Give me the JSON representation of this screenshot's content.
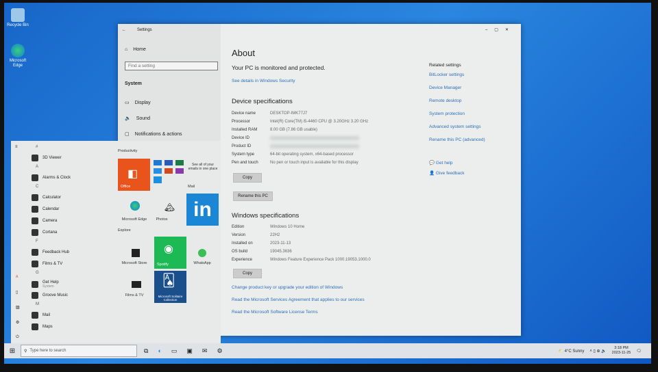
{
  "desktop": {
    "icons": [
      {
        "label": "Recycle Bin",
        "icon": "recycle-bin-icon"
      },
      {
        "label": "Microsoft Edge",
        "icon": "edge-icon"
      }
    ]
  },
  "settings": {
    "title": "Settings",
    "sidebar": {
      "home": "Home",
      "search_placeholder": "Find a setting",
      "section": "System",
      "items": [
        "Display",
        "Sound",
        "Notifications & actions"
      ]
    },
    "page_title": "About",
    "protected": "Your PC is monitored and protected.",
    "security_link": "See details in Windows Security",
    "device_specs": {
      "heading": "Device specifications",
      "rows": [
        {
          "k": "Device name",
          "v": "DESKTOP-IMK77J7"
        },
        {
          "k": "Processor",
          "v": "Intel(R) Core(TM) i5-4460  CPU @ 3.20GHz   3.20 GHz"
        },
        {
          "k": "Installed RAM",
          "v": "8.00 GB (7.86 GB usable)"
        },
        {
          "k": "Device ID",
          "v": ""
        },
        {
          "k": "Product ID",
          "v": ""
        },
        {
          "k": "System type",
          "v": "64-bit operating system, x64-based processor"
        },
        {
          "k": "Pen and touch",
          "v": "No pen or touch input is available for this display"
        }
      ],
      "copy": "Copy",
      "rename": "Rename this PC"
    },
    "windows_specs": {
      "heading": "Windows specifications",
      "rows": [
        {
          "k": "Edition",
          "v": "Windows 10 Home"
        },
        {
          "k": "Version",
          "v": "22H2"
        },
        {
          "k": "Installed on",
          "v": "2023-11-13"
        },
        {
          "k": "OS build",
          "v": "19045.3636"
        },
        {
          "k": "Experience",
          "v": "Windows Feature Experience Pack 1000.19053.1000.0"
        }
      ],
      "copy": "Copy"
    },
    "links": [
      "Change product key or upgrade your edition of Windows",
      "Read the Microsoft Services Agreement that applies to our services",
      "Read the Microsoft Software License Terms"
    ],
    "related": {
      "heading": "Related settings",
      "items": [
        "BitLocker settings",
        "Device Manager",
        "Remote desktop",
        "System protection",
        "Advanced system settings",
        "Rename this PC (advanced)"
      ],
      "help": "Get help",
      "feedback": "Give feedback"
    }
  },
  "start": {
    "apps": [
      {
        "letter": "#"
      },
      {
        "label": "3D Viewer"
      },
      {
        "letter": "A"
      },
      {
        "label": "Alarms & Clock"
      },
      {
        "letter": "C"
      },
      {
        "label": "Calculator"
      },
      {
        "label": "Calendar"
      },
      {
        "label": "Camera"
      },
      {
        "label": "Cortana"
      },
      {
        "letter": "F"
      },
      {
        "label": "Feedback Hub"
      },
      {
        "label": "Films & TV"
      },
      {
        "letter": "G"
      },
      {
        "label": "Get Help",
        "sub": "System"
      },
      {
        "label": "Groove Music"
      },
      {
        "letter": "M"
      },
      {
        "label": "Mail"
      },
      {
        "label": "Maps"
      }
    ],
    "groups": [
      "Productivity",
      "Explore"
    ],
    "tiles": {
      "office": "Office",
      "mail_text": "See all of your emails in one place",
      "mail": "Mail",
      "edge": "Microsoft Edge",
      "photos": "Photos",
      "store": "Microsoft Store",
      "spotify": "Spotify",
      "whatsapp": "WhatsApp",
      "films": "Films & TV",
      "solitaire": "Microsoft Solitaire Collection"
    }
  },
  "taskbar": {
    "search_placeholder": "Type here to search",
    "weather": "4°C  Sunny",
    "time": "3:18 PM",
    "date": "2023-11-25"
  }
}
